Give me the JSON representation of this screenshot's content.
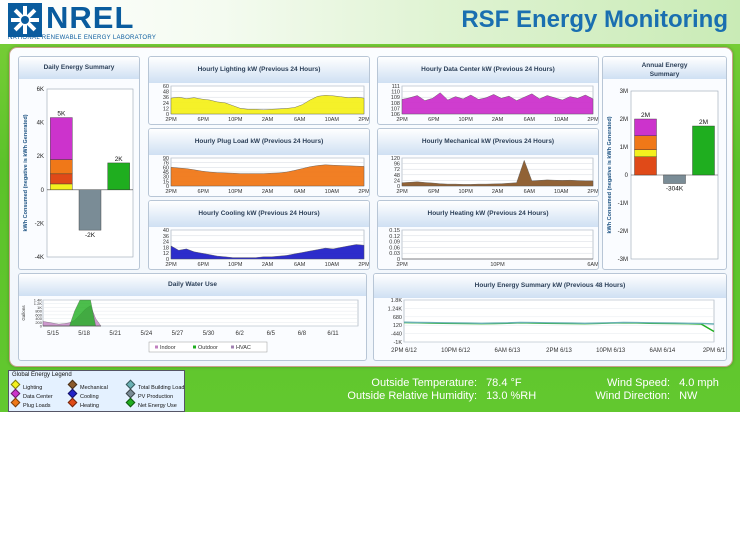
{
  "header": {
    "logo_text": "NREL",
    "logo_subtitle": "NATIONAL RENEWABLE ENERGY LABORATORY",
    "app_title": "RSF Energy Monitoring"
  },
  "colors": {
    "lighting": "#f4f01e",
    "data_center": "#cc33cc",
    "plug_loads": "#f07818",
    "cooling": "#2222c8",
    "mechanical": "#8b5a2b",
    "heating": "#e04a18",
    "pv_production": "#7a8c96",
    "net_energy": "#1fae1f",
    "total_building": "#6ab0b4"
  },
  "chart_data": [
    {
      "id": "daily-summary",
      "type": "bar",
      "title": "Daily Energy Summary",
      "ylabel": "kWh Consumed (negative is kWh Generated)",
      "ylim": [
        -4000,
        6000
      ],
      "yticks": [
        "6K",
        "4K",
        "2K",
        "0",
        "-2K",
        "-4K"
      ],
      "stacks": [
        {
          "label": "5K",
          "segments": [
            {
              "name": "Lighting",
              "value": 350
            },
            {
              "name": "Heating",
              "value": 600
            },
            {
              "name": "Plug Loads",
              "value": 850
            },
            {
              "name": "Data Center",
              "value": 2500
            }
          ]
        },
        {
          "label": "-2K",
          "segments": [
            {
              "name": "PV Production",
              "value": -2400
            }
          ]
        },
        {
          "label": "2K",
          "segments": [
            {
              "name": "Net Energy Use",
              "value": 1600
            }
          ]
        }
      ]
    },
    {
      "id": "lighting",
      "type": "area",
      "title": "Hourly Lighting kW (Previous 24 Hours)",
      "yticks": [
        "60",
        "48",
        "36",
        "24",
        "12",
        "0"
      ],
      "ylim": [
        0,
        60
      ],
      "xticks": [
        "2PM",
        "6PM",
        "10PM",
        "2AM",
        "6AM",
        "10AM",
        "2PM"
      ],
      "color": "#f4f01e",
      "values": [
        34,
        36,
        33,
        35,
        32,
        30,
        26,
        24,
        18,
        12,
        10,
        10,
        9,
        10,
        11,
        12,
        14,
        20,
        30,
        38,
        40,
        39,
        37,
        35,
        36,
        34
      ]
    },
    {
      "id": "data-center",
      "type": "area",
      "title": "Hourly Data Center kW (Previous 24 Hours)",
      "yticks": [
        "111",
        "110",
        "109",
        "108",
        "107",
        "106"
      ],
      "ylim": [
        106,
        111
      ],
      "xticks": [
        "2PM",
        "6PM",
        "10PM",
        "2AM",
        "6AM",
        "10AM",
        "2PM"
      ],
      "color": "#cc33cc",
      "values": [
        108.6,
        108.9,
        109.3,
        108.4,
        108.8,
        109.8,
        108.5,
        109.1,
        108.7,
        109.4,
        108.6,
        108.9,
        109.5,
        108.8,
        109.2,
        108.4,
        109.0,
        109.6,
        108.7,
        109.3,
        108.9,
        108.5,
        109.1,
        108.8,
        109.4,
        108.7
      ]
    },
    {
      "id": "plug-load",
      "type": "area",
      "title": "Hourly Plug Load kW (Previous 24 Hours)",
      "yticks": [
        "90",
        "76",
        "60",
        "45",
        "30",
        "15",
        "0"
      ],
      "ylim": [
        0,
        90
      ],
      "xticks": [
        "2PM",
        "6PM",
        "10PM",
        "2AM",
        "6AM",
        "10AM",
        "2PM"
      ],
      "color": "#f07818",
      "values": [
        60,
        58,
        56,
        52,
        48,
        45,
        43,
        42,
        41,
        40,
        40,
        40,
        40,
        41,
        42,
        45,
        50,
        56,
        62,
        66,
        68,
        67,
        66,
        65,
        64,
        63
      ]
    },
    {
      "id": "mechanical",
      "type": "area",
      "title": "Hourly Mechanical kW (Previous 24 Hours)",
      "yticks": [
        "120",
        "96",
        "72",
        "48",
        "24",
        "0"
      ],
      "ylim": [
        0,
        120
      ],
      "xticks": [
        "2PM",
        "6PM",
        "10PM",
        "2AM",
        "6AM",
        "10AM",
        "2PM"
      ],
      "color": "#8b5a2b",
      "values": [
        14,
        16,
        18,
        15,
        13,
        10,
        8,
        8,
        7,
        7,
        8,
        8,
        9,
        10,
        12,
        14,
        110,
        22,
        24,
        26,
        25,
        24,
        25,
        23,
        22,
        22
      ]
    },
    {
      "id": "cooling",
      "type": "area",
      "title": "Hourly Cooling kW (Previous 24 Hours)",
      "yticks": [
        "40",
        "36",
        "24",
        "18",
        "12",
        "0"
      ],
      "ylim": [
        0,
        40
      ],
      "xticks": [
        "2PM",
        "6PM",
        "10PM",
        "2AM",
        "6AM",
        "10AM",
        "2PM"
      ],
      "color": "#2222c8",
      "values": [
        18,
        12,
        14,
        10,
        8,
        6,
        4,
        3,
        2,
        2,
        2,
        2,
        3,
        3,
        4,
        5,
        7,
        9,
        11,
        13,
        15,
        14,
        16,
        18,
        20,
        19
      ]
    },
    {
      "id": "heating",
      "type": "area",
      "title": "Hourly Heating kW (Previous 24 Hours)",
      "yticks": [
        "0.15",
        "0.12",
        "0.09",
        "0.06",
        "0.03",
        "0"
      ],
      "ylim": [
        0,
        0.15
      ],
      "xticks": [
        "2PM",
        "10PM",
        "6AM"
      ],
      "color": "#e04a18",
      "values": [
        0,
        0,
        0,
        0,
        0,
        0,
        0,
        0,
        0,
        0
      ]
    },
    {
      "id": "annual-summary",
      "type": "bar",
      "title": "Annual Energy Summary",
      "ylabel": "kWh Consumed (negative is kWh Generated)",
      "ylim": [
        -3000000,
        3000000
      ],
      "yticks": [
        "3M",
        "2M",
        "1M",
        "0",
        "-1M",
        "-2M",
        "-3M"
      ],
      "stacks": [
        {
          "label": "2M",
          "segments": [
            {
              "name": "Heating",
              "value": 650000
            },
            {
              "name": "Lighting",
              "value": 250000
            },
            {
              "name": "Plug Loads",
              "value": 500000
            },
            {
              "name": "Data Center",
              "value": 600000
            }
          ]
        },
        {
          "label": "-304K",
          "segments": [
            {
              "name": "PV Production",
              "value": -304000
            }
          ]
        },
        {
          "label": "2M",
          "segments": [
            {
              "name": "Net Energy Use",
              "value": 1750000
            }
          ]
        }
      ]
    },
    {
      "id": "water",
      "type": "area",
      "title": "Daily Water Use",
      "ylabel": "Gallons",
      "yticks": [
        "1.4K",
        "1.2K",
        "1K",
        "800",
        "600",
        "400",
        "200",
        "0"
      ],
      "ylim": [
        0,
        1400
      ],
      "xticks": [
        "5/15",
        "5/18",
        "5/21",
        "5/24",
        "5/27",
        "5/30",
        "6/2",
        "6/5",
        "6/8",
        "6/11"
      ],
      "series": [
        {
          "name": "Indoor",
          "color": "#c080c0",
          "values": [
            250,
            200,
            150,
            100,
            130,
            170,
            300,
            600,
            900,
            1100,
            400,
            0
          ]
        },
        {
          "name": "Outdoor",
          "color": "#1fae1f",
          "values": [
            0,
            0,
            0,
            0,
            0,
            0,
            800,
            1400,
            1400,
            1400,
            0,
            0
          ]
        },
        {
          "name": "HVAC",
          "color": "#a080b0",
          "values": [
            0,
            0,
            0,
            0,
            0,
            0,
            0,
            0,
            0,
            0,
            0,
            0
          ]
        }
      ],
      "legend": [
        "Indoor",
        "Outdoor",
        "HVAC"
      ]
    },
    {
      "id": "summary-48",
      "type": "line",
      "title": "Hourly Energy Summary kW (Previous 48 Hours)",
      "yticks": [
        "1.8K",
        "1.24K",
        "680",
        "120",
        "-440",
        "-1K"
      ],
      "ylim": [
        -1000,
        1800
      ],
      "xticks": [
        "2PM 6/12",
        "10PM 6/12",
        "6AM 6/13",
        "2PM 6/13",
        "10PM 6/13",
        "6AM 6/14",
        "2PM 6/1"
      ],
      "series": [
        {
          "name": "Net Energy Use",
          "color": "#1fae1f",
          "values": [
            300,
            280,
            260,
            250,
            240,
            230,
            220,
            230,
            250,
            280,
            260,
            250,
            240,
            230,
            220,
            240,
            260,
            280,
            270,
            250,
            240,
            230,
            220,
            200,
            -300
          ]
        },
        {
          "name": "Total Building Load",
          "color": "#6ab0b4",
          "values": [
            320,
            300,
            290,
            280,
            270,
            260,
            250,
            260,
            270,
            300,
            290,
            280,
            270,
            260,
            250,
            260,
            280,
            300,
            290,
            280,
            270,
            260,
            250,
            240,
            200
          ]
        }
      ]
    }
  ],
  "legend": {
    "title": "Global Energy Legend",
    "items": [
      {
        "label": "Lighting",
        "color": "#f4f01e"
      },
      {
        "label": "Mechanical",
        "color": "#8b5a2b"
      },
      {
        "label": "Total Building Load",
        "color": "#6ab0b4"
      },
      {
        "label": "Data Center",
        "color": "#cc33cc"
      },
      {
        "label": "Cooling",
        "color": "#2222c8"
      },
      {
        "label": "PV Production",
        "color": "#7a8c96"
      },
      {
        "label": "Plug Loads",
        "color": "#f07818"
      },
      {
        "label": "Heating",
        "color": "#e04a18"
      },
      {
        "label": "Net Energy Use",
        "color": "#1fae1f"
      }
    ]
  },
  "weather": {
    "temp_label": "Outside Temperature:",
    "temp_value": "78.4 °F",
    "humidity_label": "Outside Relative Humidity:",
    "humidity_value": "13.0 %RH",
    "wind_speed_label": "Wind Speed:",
    "wind_speed_value": "4.0 mph",
    "wind_dir_label": "Wind Direction:",
    "wind_dir_value": "NW"
  }
}
